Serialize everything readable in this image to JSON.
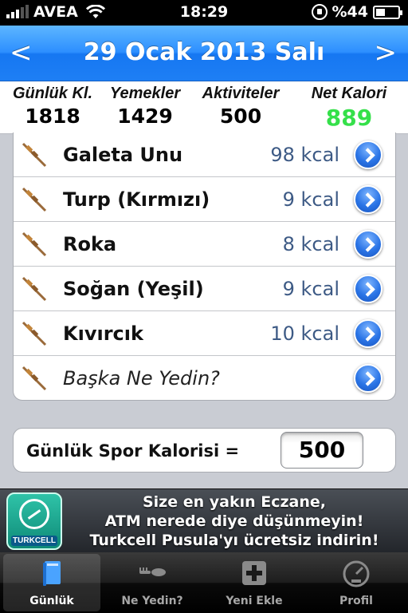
{
  "status_bar": {
    "carrier": "AVEA",
    "time": "18:29",
    "battery": "%44",
    "battery_level": 0.44
  },
  "nav": {
    "prev": "<",
    "title": "29 Ocak 2013 Salı",
    "next": ">"
  },
  "summary": [
    {
      "label": "Günlük Kl.",
      "value": "1818"
    },
    {
      "label": "Yemekler",
      "value": "1429"
    },
    {
      "label": "Aktiviteler",
      "value": "500"
    },
    {
      "label": "Net Kalori",
      "value": "889",
      "color": "#35e04a"
    }
  ],
  "foods": [
    {
      "name": "Galeta Unu",
      "kcal": "98 kcal"
    },
    {
      "name": "Turp (Kırmızı)",
      "kcal": "9 kcal"
    },
    {
      "name": "Roka",
      "kcal": "8 kcal"
    },
    {
      "name": "Soğan (Yeşil)",
      "kcal": "9 kcal"
    },
    {
      "name": "Kıvırcık",
      "kcal": "10 kcal"
    }
  ],
  "add_more": {
    "label": "Başka Ne Yedin?"
  },
  "sport": {
    "label": "Günlük Spor Kalorisi =",
    "value": "500"
  },
  "ad": {
    "line1": "Size en yakın Eczane,",
    "line2": "ATM nerede diye düşünmeyin!",
    "line3": "Turkcell Pusula'yı ücretsiz indirin!",
    "brand": "TURKCELL"
  },
  "tabs": [
    {
      "label": "Günlük",
      "icon": "book-icon",
      "active": true
    },
    {
      "label": "Ne Yedin?",
      "icon": "fork-knife-icon",
      "active": false
    },
    {
      "label": "Yeni Ekle",
      "icon": "plus-icon",
      "active": false
    },
    {
      "label": "Profil",
      "icon": "gauge-icon",
      "active": false
    }
  ],
  "colors": {
    "nav_blue": "#2d8fff",
    "net_green": "#35e04a",
    "kcal_blue": "#3d5a85"
  }
}
